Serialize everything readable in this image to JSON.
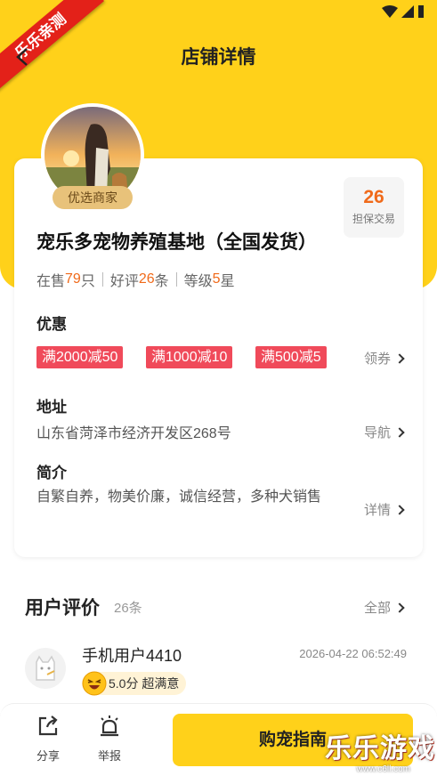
{
  "header": {
    "title": "店铺详情",
    "corner_ribbon": "乐乐亲测"
  },
  "store": {
    "badge": "优选商家",
    "trade_count": "26",
    "trade_label": "担保交易",
    "name": "宠乐多宠物养殖基地（全国发货）",
    "stats": {
      "on_sale_prefix": "在售 ",
      "on_sale_value": "79",
      "on_sale_suffix": "只",
      "good_prefix": "好评",
      "good_value": "26",
      "good_suffix": "条",
      "level_prefix": "等级",
      "level_value": "5",
      "level_suffix": "星"
    }
  },
  "discount": {
    "title": "优惠",
    "coupons": [
      "满2000减50",
      "满1000减10",
      "满500减5"
    ],
    "link": "领券"
  },
  "address": {
    "title": "地址",
    "value": "山东省菏泽市经济开发区268号",
    "link": "导航"
  },
  "intro": {
    "title": "简介",
    "value": "自繁自养，物美价廉，诚信经营，多种犬销售",
    "link": "详情"
  },
  "reviews": {
    "title": "用户评价",
    "count": "26条",
    "all_link": "全部",
    "items": [
      {
        "user": "手机用户4410",
        "time": "2026-04-22 06:52:49",
        "score": "5.0分 超满意"
      }
    ]
  },
  "bottom_bar": {
    "share": "分享",
    "report": "举报",
    "buy": "购宠指南"
  },
  "watermark": {
    "text": "乐乐游戏",
    "url": "www.c6ll.com"
  },
  "colors": {
    "brand_yellow": "#FFD11A",
    "accent_orange": "#F06A1A",
    "coupon_red": "#F04A5A"
  }
}
